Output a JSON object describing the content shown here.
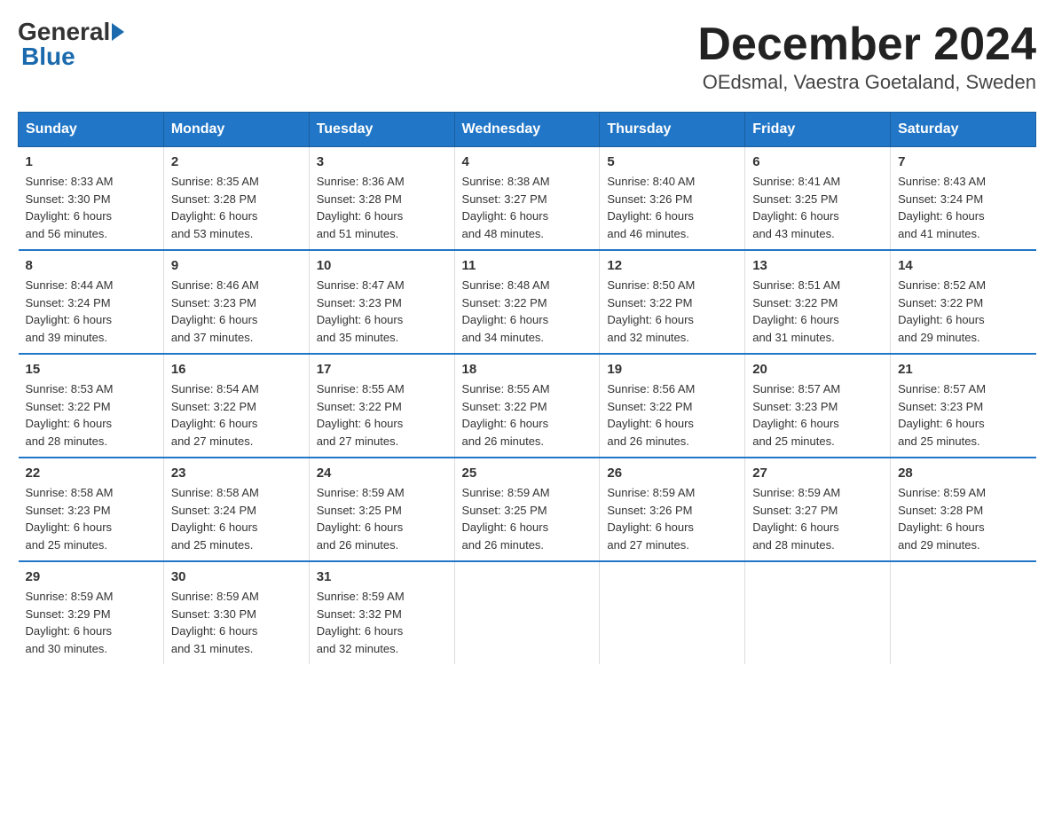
{
  "header": {
    "logo_general": "General",
    "logo_blue": "Blue",
    "month_title": "December 2024",
    "location": "OEdsmal, Vaestra Goetaland, Sweden"
  },
  "weekdays": [
    "Sunday",
    "Monday",
    "Tuesday",
    "Wednesday",
    "Thursday",
    "Friday",
    "Saturday"
  ],
  "weeks": [
    [
      {
        "day": "1",
        "info": "Sunrise: 8:33 AM\nSunset: 3:30 PM\nDaylight: 6 hours\nand 56 minutes."
      },
      {
        "day": "2",
        "info": "Sunrise: 8:35 AM\nSunset: 3:28 PM\nDaylight: 6 hours\nand 53 minutes."
      },
      {
        "day": "3",
        "info": "Sunrise: 8:36 AM\nSunset: 3:28 PM\nDaylight: 6 hours\nand 51 minutes."
      },
      {
        "day": "4",
        "info": "Sunrise: 8:38 AM\nSunset: 3:27 PM\nDaylight: 6 hours\nand 48 minutes."
      },
      {
        "day": "5",
        "info": "Sunrise: 8:40 AM\nSunset: 3:26 PM\nDaylight: 6 hours\nand 46 minutes."
      },
      {
        "day": "6",
        "info": "Sunrise: 8:41 AM\nSunset: 3:25 PM\nDaylight: 6 hours\nand 43 minutes."
      },
      {
        "day": "7",
        "info": "Sunrise: 8:43 AM\nSunset: 3:24 PM\nDaylight: 6 hours\nand 41 minutes."
      }
    ],
    [
      {
        "day": "8",
        "info": "Sunrise: 8:44 AM\nSunset: 3:24 PM\nDaylight: 6 hours\nand 39 minutes."
      },
      {
        "day": "9",
        "info": "Sunrise: 8:46 AM\nSunset: 3:23 PM\nDaylight: 6 hours\nand 37 minutes."
      },
      {
        "day": "10",
        "info": "Sunrise: 8:47 AM\nSunset: 3:23 PM\nDaylight: 6 hours\nand 35 minutes."
      },
      {
        "day": "11",
        "info": "Sunrise: 8:48 AM\nSunset: 3:22 PM\nDaylight: 6 hours\nand 34 minutes."
      },
      {
        "day": "12",
        "info": "Sunrise: 8:50 AM\nSunset: 3:22 PM\nDaylight: 6 hours\nand 32 minutes."
      },
      {
        "day": "13",
        "info": "Sunrise: 8:51 AM\nSunset: 3:22 PM\nDaylight: 6 hours\nand 31 minutes."
      },
      {
        "day": "14",
        "info": "Sunrise: 8:52 AM\nSunset: 3:22 PM\nDaylight: 6 hours\nand 29 minutes."
      }
    ],
    [
      {
        "day": "15",
        "info": "Sunrise: 8:53 AM\nSunset: 3:22 PM\nDaylight: 6 hours\nand 28 minutes."
      },
      {
        "day": "16",
        "info": "Sunrise: 8:54 AM\nSunset: 3:22 PM\nDaylight: 6 hours\nand 27 minutes."
      },
      {
        "day": "17",
        "info": "Sunrise: 8:55 AM\nSunset: 3:22 PM\nDaylight: 6 hours\nand 27 minutes."
      },
      {
        "day": "18",
        "info": "Sunrise: 8:55 AM\nSunset: 3:22 PM\nDaylight: 6 hours\nand 26 minutes."
      },
      {
        "day": "19",
        "info": "Sunrise: 8:56 AM\nSunset: 3:22 PM\nDaylight: 6 hours\nand 26 minutes."
      },
      {
        "day": "20",
        "info": "Sunrise: 8:57 AM\nSunset: 3:23 PM\nDaylight: 6 hours\nand 25 minutes."
      },
      {
        "day": "21",
        "info": "Sunrise: 8:57 AM\nSunset: 3:23 PM\nDaylight: 6 hours\nand 25 minutes."
      }
    ],
    [
      {
        "day": "22",
        "info": "Sunrise: 8:58 AM\nSunset: 3:23 PM\nDaylight: 6 hours\nand 25 minutes."
      },
      {
        "day": "23",
        "info": "Sunrise: 8:58 AM\nSunset: 3:24 PM\nDaylight: 6 hours\nand 25 minutes."
      },
      {
        "day": "24",
        "info": "Sunrise: 8:59 AM\nSunset: 3:25 PM\nDaylight: 6 hours\nand 26 minutes."
      },
      {
        "day": "25",
        "info": "Sunrise: 8:59 AM\nSunset: 3:25 PM\nDaylight: 6 hours\nand 26 minutes."
      },
      {
        "day": "26",
        "info": "Sunrise: 8:59 AM\nSunset: 3:26 PM\nDaylight: 6 hours\nand 27 minutes."
      },
      {
        "day": "27",
        "info": "Sunrise: 8:59 AM\nSunset: 3:27 PM\nDaylight: 6 hours\nand 28 minutes."
      },
      {
        "day": "28",
        "info": "Sunrise: 8:59 AM\nSunset: 3:28 PM\nDaylight: 6 hours\nand 29 minutes."
      }
    ],
    [
      {
        "day": "29",
        "info": "Sunrise: 8:59 AM\nSunset: 3:29 PM\nDaylight: 6 hours\nand 30 minutes."
      },
      {
        "day": "30",
        "info": "Sunrise: 8:59 AM\nSunset: 3:30 PM\nDaylight: 6 hours\nand 31 minutes."
      },
      {
        "day": "31",
        "info": "Sunrise: 8:59 AM\nSunset: 3:32 PM\nDaylight: 6 hours\nand 32 minutes."
      },
      {
        "day": "",
        "info": ""
      },
      {
        "day": "",
        "info": ""
      },
      {
        "day": "",
        "info": ""
      },
      {
        "day": "",
        "info": ""
      }
    ]
  ]
}
